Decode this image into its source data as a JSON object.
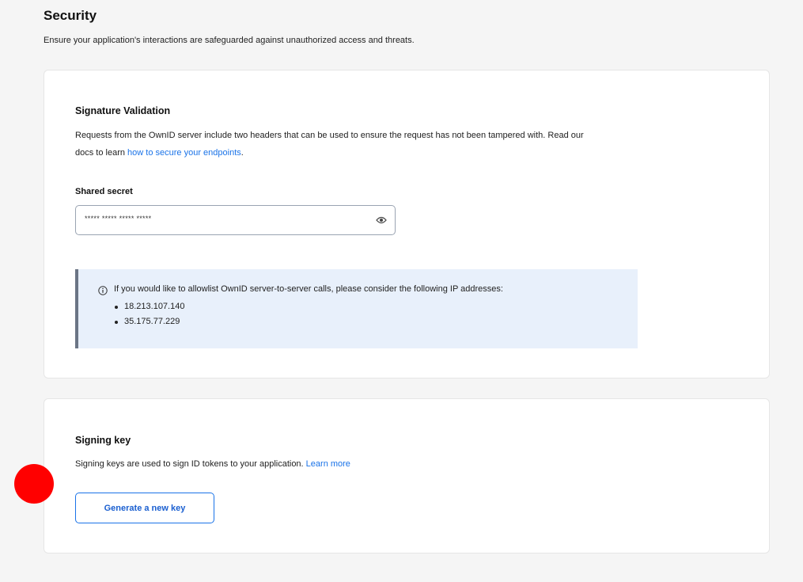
{
  "header": {
    "title": "Security",
    "subtitle": "Ensure your application's interactions are safeguarded against unauthorized access and threats."
  },
  "signature_validation": {
    "title": "Signature Validation",
    "description_line1": "Requests from the OwnID server include two headers that can be used to ensure the request has not been tampered with. Read our",
    "description_prefix": "docs to learn ",
    "link_text": "how to secure your endpoints",
    "description_suffix": ".",
    "field_label": "Shared secret",
    "secret_value": "***** ***** ***** *****",
    "reveal_icon": "eye-icon",
    "info": {
      "icon": "info-icon",
      "text": "If you would like to allowlist OwnID server-to-server calls, please consider the following IP addresses:",
      "ip_addresses": [
        "18.213.107.140",
        "35.175.77.229"
      ]
    }
  },
  "signing_key": {
    "title": "Signing key",
    "description": "Signing keys are used to sign ID tokens to your application. ",
    "link_text": "Learn more",
    "button_label": "Generate a new key"
  },
  "colors": {
    "link": "#1a73e8",
    "info_background": "#e8f0fb",
    "info_border": "#6b7585",
    "marker": "#ff0000"
  }
}
